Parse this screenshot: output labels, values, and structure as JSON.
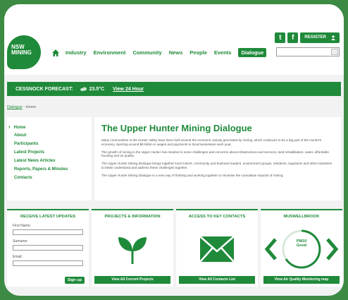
{
  "colors": {
    "brand_green": "#1f8a3a",
    "page_bg": "#3c8a44"
  },
  "header": {
    "logo_line1": "NSW",
    "logo_line2": "MINING",
    "twitter_glyph": "t",
    "facebook_glyph": "f",
    "register_label": "REGISTER",
    "search_placeholder": ""
  },
  "nav": {
    "items": [
      "Industry",
      "Environment",
      "Community",
      "News",
      "People",
      "Events"
    ],
    "active": "Dialogue"
  },
  "forecast": {
    "label": "CESSNOCK FORECAST:",
    "temperature": "23.5°C",
    "link": "View 24 Hour"
  },
  "breadcrumb": {
    "link": "Dialogue",
    "separator": " - ",
    "current": "Home"
  },
  "sidenav": {
    "items": [
      "Home",
      "About",
      "Participants",
      "Latest Projects",
      "Latest News Articles",
      "Reports, Papers & Minutes",
      "Contacts"
    ]
  },
  "content": {
    "title": "The Upper Hunter Mining Dialogue",
    "paragraphs": [
      "Many communities in the Hunter Valley have been built around the economic activity generated by mining, which continues to be a big part of the Hunter's economy, injecting around $6 billion in wages and payments to local businesses each year.",
      "The growth of mining in the Upper Hunter has resulted in some challenges and concerns about infrastructure and services, land rehabilitation, water, affordable housing and air quality.",
      "The Upper Hunter Mining Dialogue brings together local miners, community and business leaders, environment groups, residents, regulators and other industries to better understand and address these challenges together.",
      "The Upper Hunter Mining Dialogue is a new way of thinking and working together to minimise the cumulative impacts of mining."
    ]
  },
  "cards": {
    "updates": {
      "title": "RECEIVE LATEST UPDATES",
      "first_name_label": "First Name:",
      "surname_label": "Surname:",
      "email_label": "Email:",
      "button": "Sign up"
    },
    "projects": {
      "title": "PROJECTS & INFORMATION",
      "button": "View All Current Projects"
    },
    "contacts": {
      "title": "ACCESS TO KEY CONTACTS",
      "button": "View All Contacts List"
    },
    "air": {
      "title": "MUSWELLBROOK",
      "pm_label": "PM10",
      "status": "Good",
      "button": "View Air Quality Monitoring map"
    }
  }
}
